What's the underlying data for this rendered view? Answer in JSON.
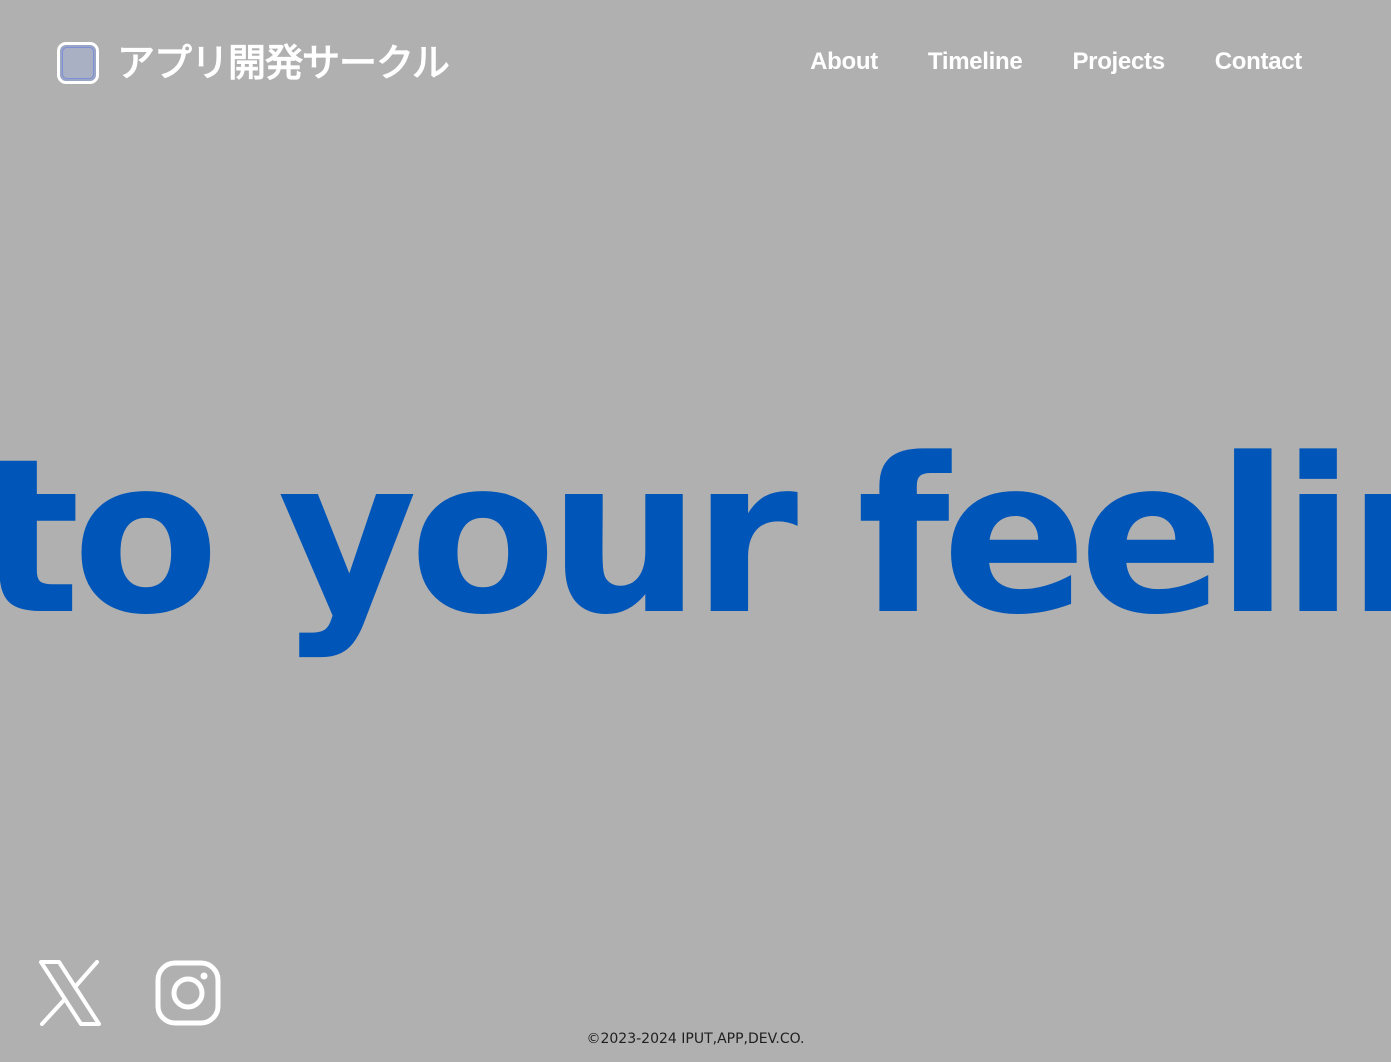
{
  "header": {
    "brand": "アプリ開発サークル",
    "nav": [
      {
        "label": "About"
      },
      {
        "label": "Timeline"
      },
      {
        "label": "Projects"
      },
      {
        "label": "Contact"
      }
    ]
  },
  "hero": {
    "marquee_text": "to your feelings"
  },
  "social": {
    "x_icon": "x-logo-icon",
    "instagram_icon": "instagram-logo-icon"
  },
  "footer": {
    "copyright": "©2023-2024 IPUT,APP,DEV.CO."
  },
  "colors": {
    "background": "#b0b0b0",
    "accent": "#0055b8",
    "text": "#ffffff"
  }
}
